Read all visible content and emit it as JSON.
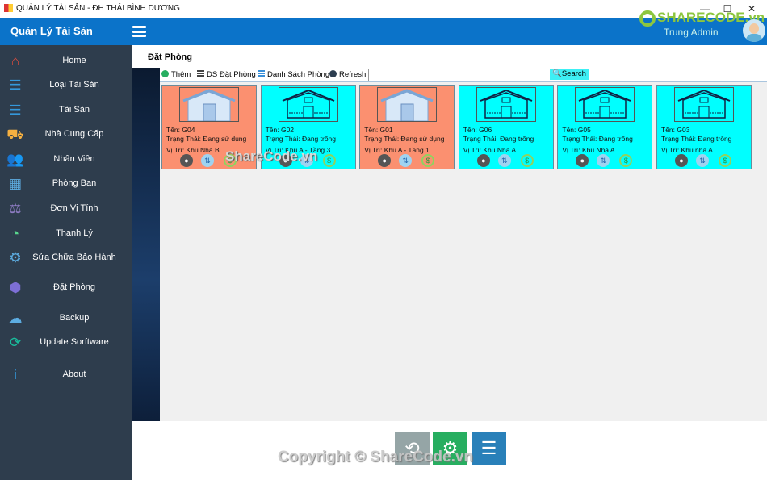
{
  "window": {
    "title": "QUẢN LÝ TÀI SẢN - ĐH THÁI BÌNH DƯƠNG",
    "minimize": "—",
    "maximize": "☐",
    "close": "✕"
  },
  "header": {
    "brand": "Quản Lý Tài Sản",
    "logo": "SHARECODE.vn",
    "user": "Trung Admin",
    "color": "#0b73c9"
  },
  "sidebar": {
    "items": [
      {
        "label": "Home",
        "icon": "home-icon",
        "glyph": "⌂",
        "color": "#e74c3c"
      },
      {
        "label": "Loại Tài Sản",
        "icon": "list-icon",
        "glyph": "☰",
        "color": "#3498db"
      },
      {
        "label": "Tài Sản",
        "icon": "list-icon",
        "glyph": "☰",
        "color": "#3498db"
      },
      {
        "label": "Nhà Cung Cấp",
        "icon": "supplier-icon",
        "glyph": "⛟",
        "color": "#f5b041"
      },
      {
        "label": "Nhân Viên",
        "icon": "users-icon",
        "glyph": "👥",
        "color": "#f39c12"
      },
      {
        "label": "Phòng Ban",
        "icon": "building-icon",
        "glyph": "▦",
        "color": "#5dade2"
      },
      {
        "label": "Đơn Vị Tính",
        "icon": "scale-icon",
        "glyph": "⚖",
        "color": "#8e7cc3"
      },
      {
        "label": "Thanh Lý",
        "icon": "recycle-icon",
        "glyph": "◔",
        "color": "#58d68d"
      },
      {
        "label": "Sửa Chữa Bảo Hành",
        "icon": "gears-icon",
        "glyph": "⚙",
        "color": "#5dade2"
      },
      {
        "label": "Đặt Phòng",
        "icon": "cube-icon",
        "glyph": "⬢",
        "color": "#7d6fd6"
      },
      {
        "label": "Backup",
        "icon": "backup-icon",
        "glyph": "☁",
        "color": "#5dade2"
      },
      {
        "label": "Update Sorftware",
        "icon": "update-icon",
        "glyph": "⟳",
        "color": "#1abc9c"
      },
      {
        "label": "About",
        "icon": "info-icon",
        "glyph": "i",
        "color": "#3498db"
      }
    ]
  },
  "page": {
    "title": "Đặt Phòng"
  },
  "toolbar": {
    "add": "Thêm",
    "bookings": "DS Đặt Phòng",
    "rooms": "Danh Sách Phòng",
    "refresh": "Refresh",
    "search_value": "",
    "search": "Search"
  },
  "rooms": [
    {
      "name": "Tên: G04",
      "status": "Trạng Thái: Đang sử dụng",
      "location": "Vị Trí: Khu Nhà B",
      "color": "#fb9070"
    },
    {
      "name": "Tên: G02",
      "status": "Trạng Thái: Đang trống",
      "location": "Vị Trí: Khu A - Tầng 3",
      "color": "#00ffff"
    },
    {
      "name": "Tên: G01",
      "status": "Trạng Thái: Đang sử dụng",
      "location": "Vị Trí: Khu A - Tầng 1",
      "color": "#fb9070"
    },
    {
      "name": "Tên: G06",
      "status": "Trạng Thái: Đang trống",
      "location": "Vị Trí: Khu Nhà A",
      "color": "#00ffff"
    },
    {
      "name": "Tên: G05",
      "status": "Trạng Thái: Đang trống",
      "location": "Vị Trí: Khu Nhà A",
      "color": "#00ffff"
    },
    {
      "name": "Tên: G03",
      "status": "Trạng Thái: Đang trống",
      "location": "Vị Trí: Khu nhà A",
      "color": "#00ffff"
    }
  ],
  "footer": {
    "copyright": "Copyright © ShareCode.vn",
    "watermark": "ShareCode.vn"
  }
}
